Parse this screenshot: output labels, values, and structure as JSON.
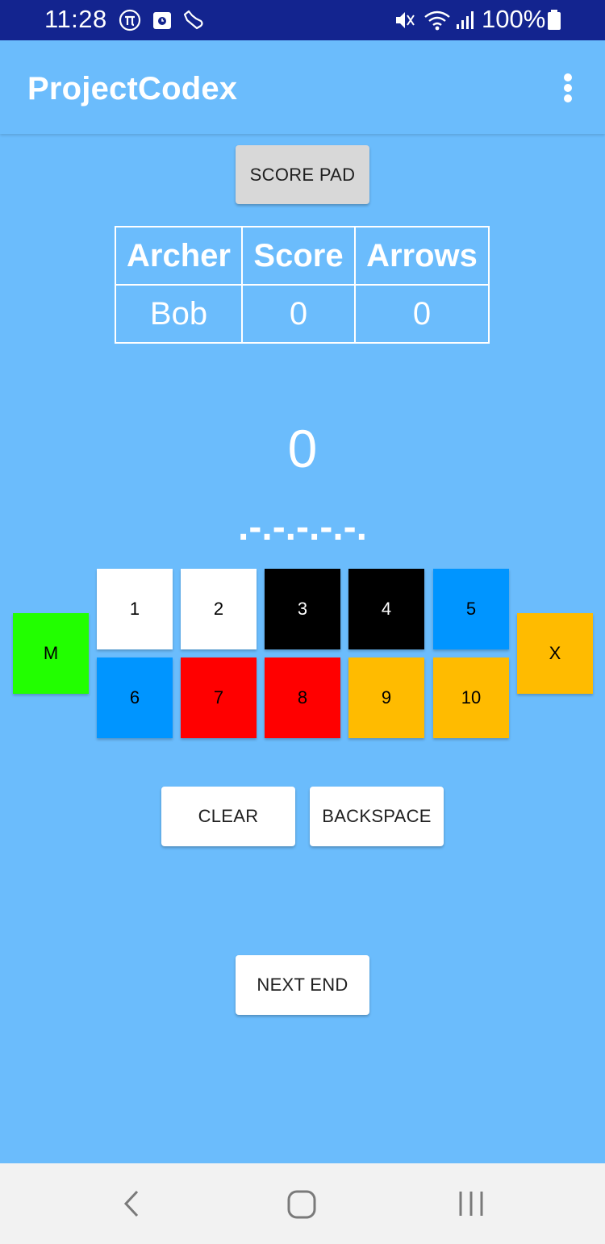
{
  "status_bar": {
    "time": "11:28",
    "battery": "100%",
    "left_icons": [
      "pi-icon",
      "calendar-icon",
      "sneaker-icon"
    ],
    "right_icons": [
      "mute-icon",
      "wifi-icon",
      "signal-icon",
      "battery-icon"
    ]
  },
  "app_bar": {
    "title": "ProjectCodex",
    "menu_icon": "overflow-menu-icon"
  },
  "score_pad_button": "SCORE PAD",
  "table": {
    "headers": [
      "Archer",
      "Score",
      "Arrows"
    ],
    "rows": [
      [
        "Bob",
        "0",
        "0"
      ]
    ]
  },
  "current_total": "0",
  "arrow_slots": ".-.-.-.-.-.",
  "keys": {
    "miss": {
      "label": "M",
      "color": "#22ff00"
    },
    "x": {
      "label": "X",
      "color": "#ffbb00"
    },
    "row1": [
      {
        "label": "1",
        "color": "#ffffff"
      },
      {
        "label": "2",
        "color": "#ffffff"
      },
      {
        "label": "3",
        "color": "#000000"
      },
      {
        "label": "4",
        "color": "#000000"
      },
      {
        "label": "5",
        "color": "#0095ff"
      }
    ],
    "row2": [
      {
        "label": "6",
        "color": "#0095ff"
      },
      {
        "label": "7",
        "color": "#ff0000"
      },
      {
        "label": "8",
        "color": "#ff0000"
      },
      {
        "label": "9",
        "color": "#ffbb00"
      },
      {
        "label": "10",
        "color": "#ffbb00"
      }
    ]
  },
  "clear_button": "CLEAR",
  "backspace_button": "BACKSPACE",
  "next_end_button": "NEXT END",
  "colors": {
    "background": "#6bbcfc",
    "status_bar": "#13248f",
    "nav_bar": "#f2f2f2"
  },
  "nav_bar": {
    "icons": [
      "back-icon",
      "home-icon",
      "recents-icon"
    ]
  }
}
